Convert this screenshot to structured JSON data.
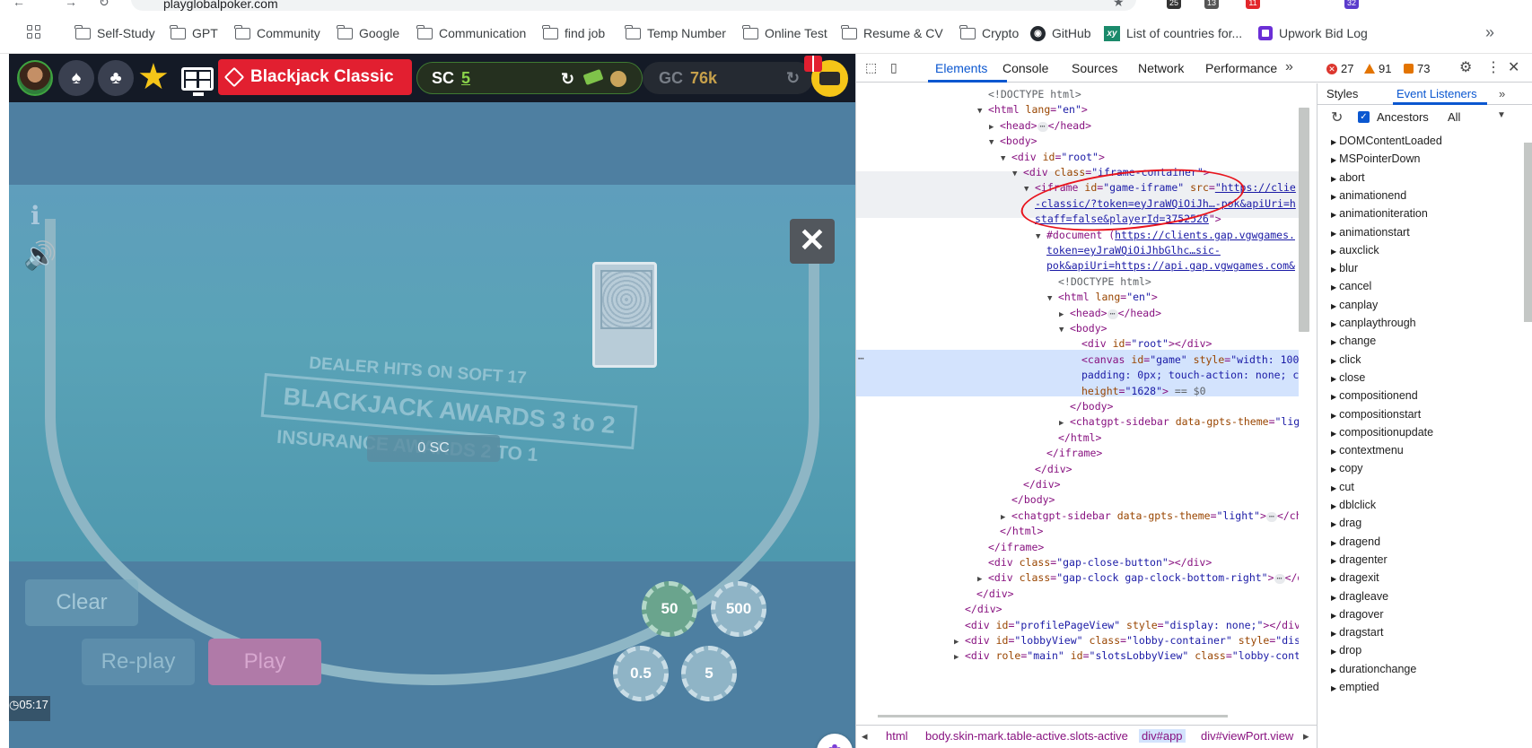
{
  "browser": {
    "url": "playglobalpoker.com",
    "extension_badges": [
      "25",
      "13",
      "11",
      "32"
    ],
    "bookmarks": [
      {
        "label": "Self-Study",
        "icon": "folder-icon"
      },
      {
        "label": "GPT",
        "icon": "folder-icon"
      },
      {
        "label": "Community",
        "icon": "folder-icon"
      },
      {
        "label": "Google",
        "icon": "folder-icon"
      },
      {
        "label": "Communication",
        "icon": "folder-icon"
      },
      {
        "label": "find job",
        "icon": "folder-icon"
      },
      {
        "label": "Temp Number",
        "icon": "folder-icon"
      },
      {
        "label": "Online Test",
        "icon": "folder-icon"
      },
      {
        "label": "Resume & CV",
        "icon": "folder-icon"
      },
      {
        "label": "Crypto",
        "icon": "folder-icon"
      },
      {
        "label": "GitHub",
        "icon": "github-icon"
      },
      {
        "label": "List of countries for...",
        "icon": "xy-icon"
      },
      {
        "label": "Upwork Bid Log",
        "icon": "upwork-icon"
      }
    ],
    "more": "»"
  },
  "game": {
    "title": "Blackjack Classic",
    "sc_label": "SC",
    "sc_value": "5",
    "gc_label": "GC",
    "gc_value": "76k",
    "close": "✕",
    "info": "i",
    "felt_line1": "DEALER HITS ON SOFT 17",
    "felt_line2": "BLACKJACK AWARDS 3 to 2",
    "felt_line3": "INSURANCE AWARDS 2 TO 1",
    "bet_amount": "0 SC",
    "buttons": {
      "clear": "Clear",
      "replay": "Re-play",
      "play": "Play"
    },
    "chips": [
      "50",
      "500",
      "0.5",
      "5"
    ],
    "clock": "05:17"
  },
  "devtools": {
    "tabs": [
      "Elements",
      "Console",
      "Sources",
      "Network",
      "Performance"
    ],
    "active_tab": "Elements",
    "tabs_more": "»",
    "errors": "27",
    "warnings": "91",
    "issues": "73",
    "dom_lines": [
      {
        "indent": 0,
        "parts": [
          [
            "cm",
            "<!DOCTYPE html>"
          ]
        ]
      },
      {
        "indent": 0,
        "tri": "▼",
        "parts": [
          [
            "tag",
            "<html "
          ],
          [
            "an",
            "lang"
          ],
          [
            "tag",
            "="
          ],
          [
            "av",
            "\"en\""
          ],
          [
            "tag",
            ">"
          ]
        ]
      },
      {
        "indent": 1,
        "tri": "▶",
        "parts": [
          [
            "tag",
            "<head>"
          ],
          [
            "ell",
            "⋯"
          ],
          [
            "tag",
            "</head>"
          ]
        ]
      },
      {
        "indent": 1,
        "tri": "▼",
        "parts": [
          [
            "tag",
            "<body>"
          ]
        ]
      },
      {
        "indent": 2,
        "tri": "▼",
        "parts": [
          [
            "tag",
            "<div "
          ],
          [
            "an",
            "id"
          ],
          [
            "tag",
            "="
          ],
          [
            "av",
            "\"root\""
          ],
          [
            "tag",
            ">"
          ]
        ]
      },
      {
        "indent": 3,
        "tri": "▼",
        "parts": [
          [
            "tag",
            "<div "
          ],
          [
            "an",
            "class"
          ],
          [
            "tag",
            "="
          ],
          [
            "av",
            "\"iframe-container\""
          ],
          [
            "tag",
            ">"
          ]
        ]
      },
      {
        "indent": 4,
        "tri": "▼",
        "parts": [
          [
            "tag",
            "<iframe "
          ],
          [
            "an",
            "id"
          ],
          [
            "tag",
            "="
          ],
          [
            "av",
            "\"game-iframe\""
          ],
          [
            "an",
            " src"
          ],
          [
            "tag",
            "="
          ],
          [
            "lk",
            "\"https://clie"
          ]
        ]
      },
      {
        "indent": 4,
        "parts": [
          [
            "lk",
            "-classic/?token=eyJraWQiOiJh…-pok&apiUri=h"
          ]
        ]
      },
      {
        "indent": 4,
        "parts": [
          [
            "lk",
            "staff=false&playerId=3752526"
          ],
          [
            "tag",
            "\">"
          ]
        ]
      },
      {
        "indent": 5,
        "tri": "▼",
        "parts": [
          [
            "tag",
            "#document ("
          ],
          [
            "lk",
            "https://clients.gap.vgwgames."
          ]
        ]
      },
      {
        "indent": 5,
        "parts": [
          [
            "lk",
            "token=eyJraWQiOiJhbGlhc…sic-"
          ]
        ]
      },
      {
        "indent": 5,
        "parts": [
          [
            "lk",
            "pok&apiUri=https://api.gap.vgwgames.com&"
          ]
        ]
      },
      {
        "indent": 6,
        "parts": [
          [
            "cm",
            "<!DOCTYPE html>"
          ]
        ]
      },
      {
        "indent": 6,
        "tri": "▼",
        "parts": [
          [
            "tag",
            "<html "
          ],
          [
            "an",
            "lang"
          ],
          [
            "tag",
            "="
          ],
          [
            "av",
            "\"en\""
          ],
          [
            "tag",
            ">"
          ]
        ]
      },
      {
        "indent": 7,
        "tri": "▶",
        "parts": [
          [
            "tag",
            "<head>"
          ],
          [
            "ell",
            "⋯"
          ],
          [
            "tag",
            "</head>"
          ]
        ]
      },
      {
        "indent": 7,
        "tri": "▼",
        "parts": [
          [
            "tag",
            "<body>"
          ]
        ]
      },
      {
        "indent": 8,
        "parts": [
          [
            "tag",
            "<div "
          ],
          [
            "an",
            "id"
          ],
          [
            "tag",
            "="
          ],
          [
            "av",
            "\"root\""
          ],
          [
            "tag",
            "></div>"
          ]
        ]
      },
      {
        "indent": 8,
        "parts": [
          [
            "tag",
            "<canvas "
          ],
          [
            "an",
            "id"
          ],
          [
            "tag",
            "="
          ],
          [
            "av",
            "\"game\""
          ],
          [
            "an",
            " style"
          ],
          [
            "tag",
            "="
          ],
          [
            "av",
            "\"width: 100"
          ]
        ]
      },
      {
        "indent": 8,
        "parts": [
          [
            "av",
            "padding: 0px; touch-action: none; c"
          ]
        ]
      },
      {
        "indent": 8,
        "parts": [
          [
            "an",
            "height"
          ],
          [
            "tag",
            "="
          ],
          [
            "av",
            "\"1628\""
          ],
          [
            "tag",
            "> "
          ],
          [
            "cm",
            "== $0"
          ]
        ]
      },
      {
        "indent": 7,
        "parts": [
          [
            "tag",
            "</body>"
          ]
        ]
      },
      {
        "indent": 7,
        "tri": "▶",
        "parts": [
          [
            "tag",
            "<chatgpt-sidebar "
          ],
          [
            "an",
            "data-gpts-theme"
          ],
          [
            "tag",
            "="
          ],
          [
            "av",
            "\"lig"
          ]
        ]
      },
      {
        "indent": 6,
        "parts": [
          [
            "tag",
            "</html>"
          ]
        ]
      },
      {
        "indent": 5,
        "parts": [
          [
            "tag",
            "</iframe>"
          ]
        ]
      },
      {
        "indent": 4,
        "parts": [
          [
            "tag",
            "</div>"
          ]
        ]
      },
      {
        "indent": 3,
        "parts": [
          [
            "tag",
            "</div>"
          ]
        ]
      },
      {
        "indent": 2,
        "parts": [
          [
            "tag",
            "</body>"
          ]
        ]
      },
      {
        "indent": 2,
        "tri": "▶",
        "parts": [
          [
            "tag",
            "<chatgpt-sidebar "
          ],
          [
            "an",
            "data-gpts-theme"
          ],
          [
            "tag",
            "="
          ],
          [
            "av",
            "\"light\""
          ],
          [
            "tag",
            ">"
          ],
          [
            "ell",
            "⋯"
          ],
          [
            "tag",
            "</ch"
          ]
        ]
      },
      {
        "indent": 1,
        "parts": [
          [
            "tag",
            "</html>"
          ]
        ]
      },
      {
        "indent": 0,
        "parts": [
          [
            "tag",
            "</iframe>"
          ]
        ]
      },
      {
        "indent": 0,
        "parts": [
          [
            "tag",
            "<div "
          ],
          [
            "an",
            "class"
          ],
          [
            "tag",
            "="
          ],
          [
            "av",
            "\"gap-close-button\""
          ],
          [
            "tag",
            "></div>"
          ]
        ]
      },
      {
        "indent": 0,
        "tri": "▶",
        "parts": [
          [
            "tag",
            "<div "
          ],
          [
            "an",
            "class"
          ],
          [
            "tag",
            "="
          ],
          [
            "av",
            "\"gap-clock gap-clock-bottom-right\""
          ],
          [
            "tag",
            ">"
          ],
          [
            "ell",
            "⋯"
          ],
          [
            "tag",
            "</di"
          ]
        ]
      },
      {
        "indent": -1,
        "parts": [
          [
            "tag",
            "</div>"
          ]
        ]
      },
      {
        "indent": -2,
        "parts": [
          [
            "tag",
            "</div>"
          ]
        ]
      },
      {
        "indent": -2,
        "parts": [
          [
            "tag",
            "<div "
          ],
          [
            "an",
            "id"
          ],
          [
            "tag",
            "="
          ],
          [
            "av",
            "\"profilePageView\""
          ],
          [
            "an",
            " style"
          ],
          [
            "tag",
            "="
          ],
          [
            "av",
            "\"display: none;\""
          ],
          [
            "tag",
            "></div>"
          ]
        ]
      },
      {
        "indent": -2,
        "tri": "▶",
        "parts": [
          [
            "tag",
            "<div "
          ],
          [
            "an",
            "id"
          ],
          [
            "tag",
            "="
          ],
          [
            "av",
            "\"lobbyView\""
          ],
          [
            "an",
            " class"
          ],
          [
            "tag",
            "="
          ],
          [
            "av",
            "\"lobby-container\""
          ],
          [
            "an",
            " style"
          ],
          [
            "tag",
            "="
          ],
          [
            "av",
            "\"displa"
          ]
        ]
      },
      {
        "indent": -2,
        "tri": "▶",
        "parts": [
          [
            "tag",
            "<div "
          ],
          [
            "an",
            "role"
          ],
          [
            "tag",
            "="
          ],
          [
            "av",
            "\"main\""
          ],
          [
            "an",
            " id"
          ],
          [
            "tag",
            "="
          ],
          [
            "av",
            "\"slotsLobbyView\""
          ],
          [
            "an",
            " class"
          ],
          [
            "tag",
            "="
          ],
          [
            "av",
            "\"lobby-contair"
          ]
        ]
      }
    ],
    "breadcrumbs": [
      "html",
      "body.skin-mark.table-active.slots-active",
      "div#app",
      "div#viewPort.view"
    ],
    "side_tabs": [
      "Styles",
      "Event Listeners"
    ],
    "side_active": "Event Listeners",
    "ancestors_label": "Ancestors",
    "filter_value": "All",
    "events": [
      "DOMContentLoaded",
      "MSPointerDown",
      "abort",
      "animationend",
      "animationiteration",
      "animationstart",
      "auxclick",
      "blur",
      "cancel",
      "canplay",
      "canplaythrough",
      "change",
      "click",
      "close",
      "compositionend",
      "compositionstart",
      "compositionupdate",
      "contextmenu",
      "copy",
      "cut",
      "dblclick",
      "drag",
      "dragend",
      "dragenter",
      "dragexit",
      "dragleave",
      "dragover",
      "dragstart",
      "drop",
      "durationchange",
      "emptied"
    ]
  }
}
